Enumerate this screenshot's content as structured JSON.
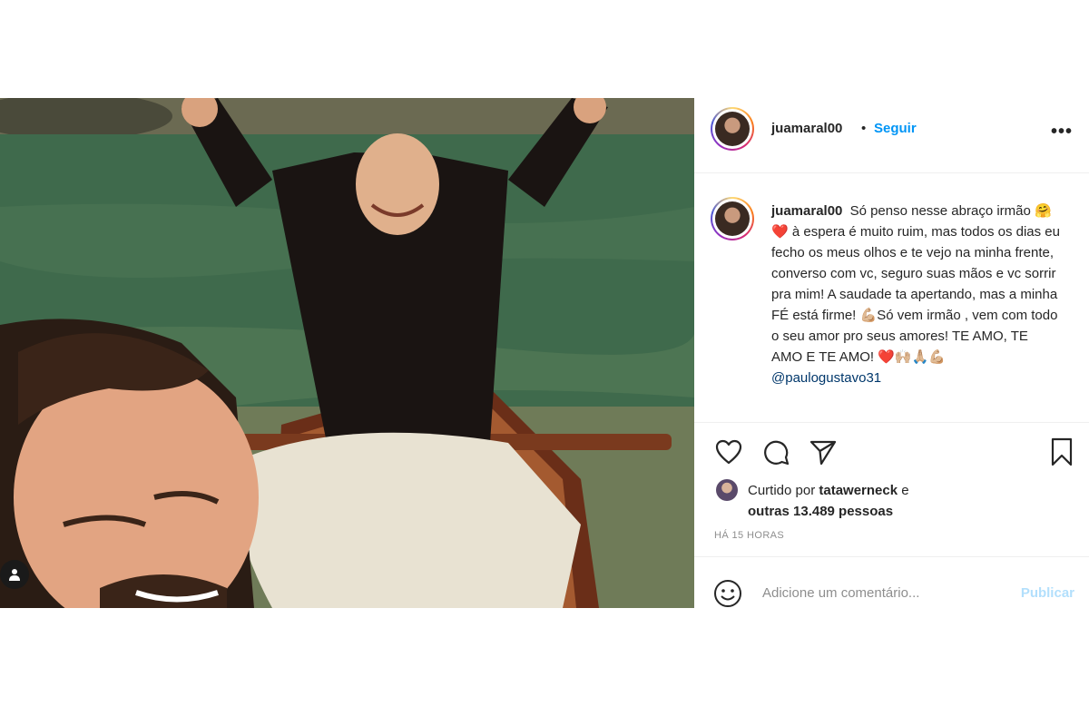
{
  "post": {
    "author": "juamaral00",
    "separator": "•",
    "follow_label": "Seguir",
    "more_label": "•••",
    "caption_line1": "Só penso nesse abraço irmão 🤗❤️ à espera é muito ruim, mas todos os dias eu fecho os meus olhos e te vejo na minha frente, converso com vc, seguro suas mãos e vc sorrir pra mim! A saudade ta apertando, mas a minha FÉ está firme! 💪🏼Só vem irmão , vem com todo o seu amor pro seus amores! TE AMO, TE AMO E TE AMO! ❤️🙌🏼🙏🏼💪🏼",
    "caption_overflow": "@paulogustavo31",
    "liked_by_prefix": "Curtido por",
    "liked_by_user": "tatawerneck",
    "liked_by_connector": "e",
    "liked_by_others": "outras 13.489 pessoas",
    "time_ago": "HÁ 15 HORAS",
    "comment_placeholder": "Adicione um comentário...",
    "publish_label": "Publicar"
  },
  "icons": {
    "like": "heart-icon",
    "comment": "comment-icon",
    "share": "paper-plane-icon",
    "save": "bookmark-icon",
    "emoji": "smiley-icon",
    "tagged_user": "user-icon"
  },
  "colors": {
    "accent": "#0095f6",
    "publish_disabled": "#b2dffc",
    "muted": "#8e8e8e",
    "text": "#262626"
  }
}
